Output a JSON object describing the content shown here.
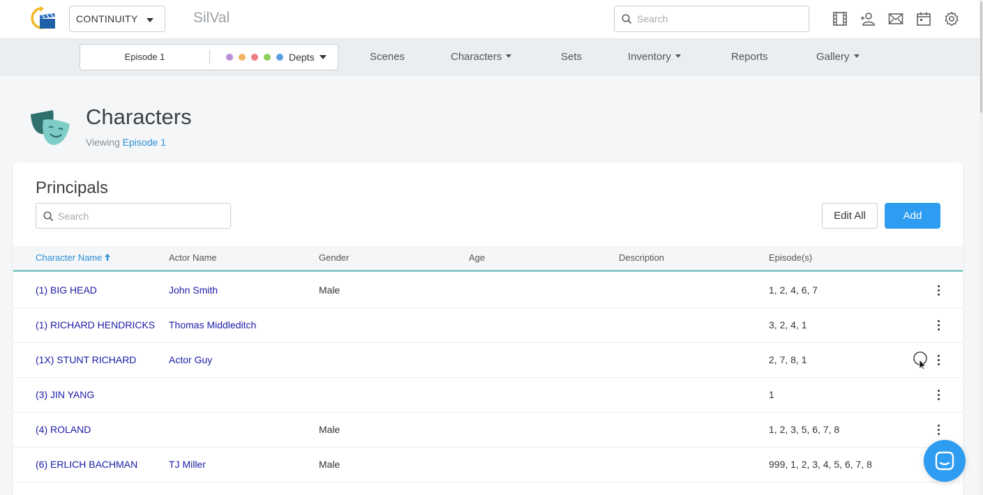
{
  "topbar": {
    "project": "CONTINUITY",
    "brand": "SilVal",
    "search_placeholder": "Search",
    "icons": [
      "film-icon",
      "add-user-icon",
      "mail-icon",
      "calendar-icon",
      "gear-icon"
    ]
  },
  "navbar": {
    "episode": "Episode 1",
    "dept_dots": [
      "#b98fd8",
      "#f4b263",
      "#ea7d86",
      "#8fcf5e",
      "#5b9fe0"
    ],
    "depts_label": "Depts",
    "items": [
      {
        "label": "Scenes",
        "has_caret": false
      },
      {
        "label": "Characters",
        "has_caret": true
      },
      {
        "label": "Sets",
        "has_caret": false
      },
      {
        "label": "Inventory",
        "has_caret": true
      },
      {
        "label": "Reports",
        "has_caret": false
      },
      {
        "label": "Gallery",
        "has_caret": true
      }
    ]
  },
  "page": {
    "title": "Characters",
    "viewing_prefix": "Viewing",
    "viewing_link": "Episode 1"
  },
  "card": {
    "title": "Principals",
    "search_placeholder": "Search",
    "edit_all_label": "Edit All",
    "add_label": "Add"
  },
  "table": {
    "columns": {
      "character": "Character Name",
      "actor": "Actor Name",
      "gender": "Gender",
      "age": "Age",
      "description": "Description",
      "episodes": "Episode(s)"
    },
    "rows": [
      {
        "character": "(1) BIG HEAD",
        "actor": "John Smith",
        "gender": "Male",
        "age": "",
        "description": "",
        "episodes": "1, 2, 4, 6, 7"
      },
      {
        "character": "(1) RICHARD HENDRICKS",
        "actor": "Thomas Middleditch",
        "gender": "",
        "age": "",
        "description": "",
        "episodes": "3, 2, 4, 1"
      },
      {
        "character": "(1X) STUNT RICHARD",
        "actor": "Actor Guy",
        "gender": "",
        "age": "",
        "description": "",
        "episodes": "2, 7, 8, 1"
      },
      {
        "character": "(3) JIN YANG",
        "actor": "",
        "gender": "",
        "age": "",
        "description": "",
        "episodes": "1"
      },
      {
        "character": "(4) ROLAND",
        "actor": "",
        "gender": "Male",
        "age": "",
        "description": "",
        "episodes": "1, 2, 3, 5, 6, 7, 8"
      },
      {
        "character": "(6) ERLICH BACHMAN",
        "actor": "TJ Miller",
        "gender": "Male",
        "age": "",
        "description": "",
        "episodes": "999, 1, 2, 3, 4, 5, 6, 7, 8"
      }
    ]
  },
  "colors": {
    "accent": "#2e9cf0",
    "link": "#1a1aa6",
    "header_underline": "#86c9c6"
  }
}
